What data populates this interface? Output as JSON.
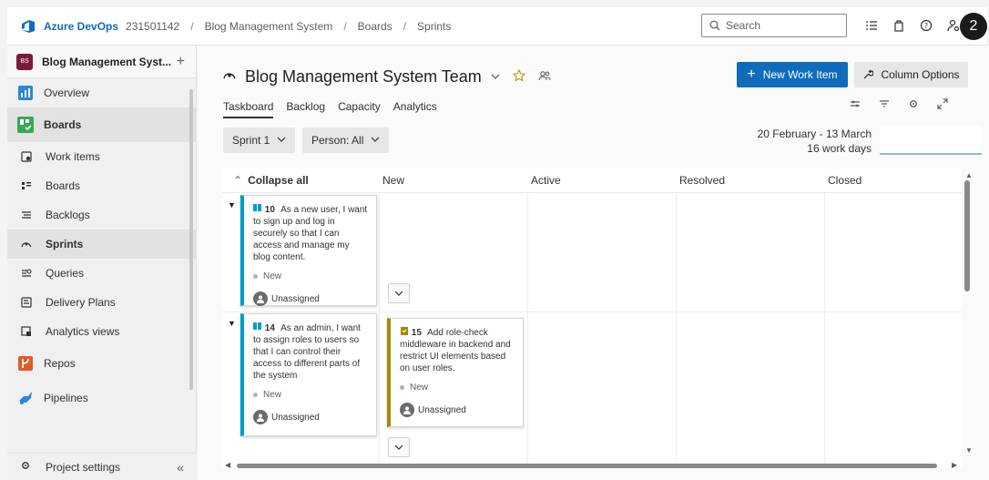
{
  "topbar": {
    "org": "Azure DevOps",
    "org_id": "231501142",
    "breadcrumbs": [
      "Blog Management System",
      "Boards",
      "Sprints"
    ],
    "search_placeholder": "Search",
    "badge": "2"
  },
  "sidebar": {
    "project_initials": "BS",
    "project_name": "Blog Management Syst...",
    "items": [
      {
        "label": "Overview"
      },
      {
        "label": "Boards"
      },
      {
        "label": "Work items"
      },
      {
        "label": "Boards"
      },
      {
        "label": "Backlogs"
      },
      {
        "label": "Sprints"
      },
      {
        "label": "Queries"
      },
      {
        "label": "Delivery Plans"
      },
      {
        "label": "Analytics views"
      },
      {
        "label": "Repos"
      },
      {
        "label": "Pipelines"
      }
    ],
    "settings": "Project settings",
    "collapse_glyph": "«"
  },
  "main": {
    "team_title": "Blog Management System Team",
    "new_work_item": "New Work Item",
    "column_options": "Column Options",
    "tabs": [
      "Taskboard",
      "Backlog",
      "Capacity",
      "Analytics"
    ],
    "sprint_filter": "Sprint 1",
    "person_filter": "Person: All",
    "date_range": "20 February - 13 March",
    "work_days": "16 work days"
  },
  "board": {
    "columns": [
      "Collapse all",
      "New",
      "Active",
      "Resolved",
      "Closed"
    ],
    "cards": [
      {
        "id": "10",
        "title": "As a new user, I want to sign up and log in securely so that I can access and manage my blog content.",
        "state": "New",
        "assignee": "Unassigned"
      },
      {
        "id": "14",
        "title": "As an admin, I want to assign roles to users so that I can control their access to different parts of the system",
        "state": "New",
        "assignee": "Unassigned"
      },
      {
        "id": "15",
        "title": "Add role-check middleware in backend and restrict UI elements based on user roles.",
        "state": "New",
        "assignee": "Unassigned"
      }
    ]
  },
  "colors": {
    "accent": "#0f6cbd",
    "story": "#009ccc",
    "task": "#a4880a"
  }
}
